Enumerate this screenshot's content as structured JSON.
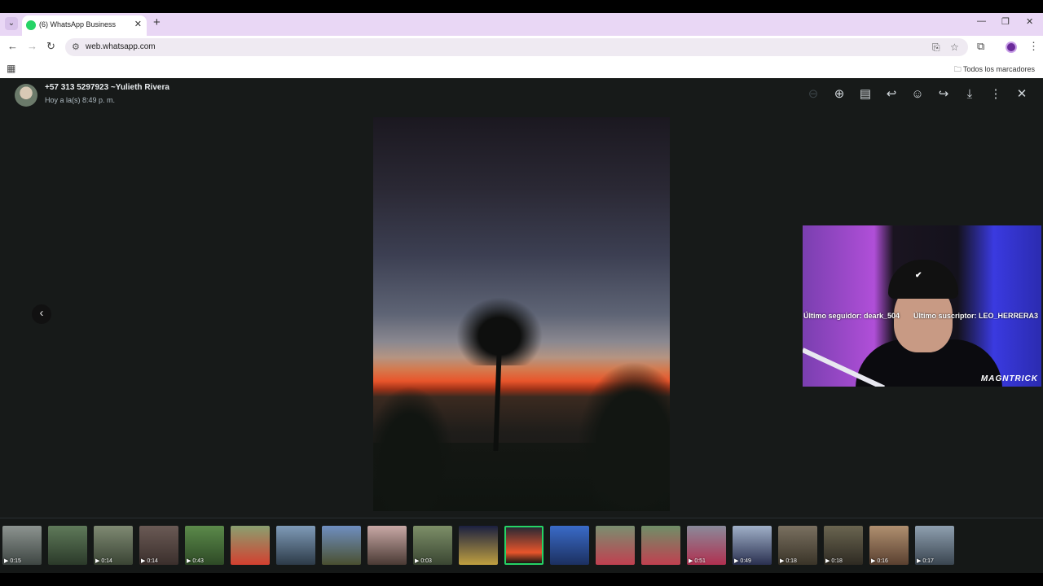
{
  "browser": {
    "tab_title": "(6) WhatsApp Business",
    "url": "web.whatsapp.com",
    "bookmarks_all": "Todos los marcadores"
  },
  "viewer": {
    "contact_name": "+57 313 5297923 ~Yulieth Rivera",
    "timestamp": "Hoy a la(s) 8:49 p. m.",
    "accent_color": "#25d366"
  },
  "stream_overlay": {
    "brand": "MAGNTRICK",
    "last_follower": "Último seguidor: deark_504",
    "last_subscriber": "Último suscriptor: LEO_HERRERA3"
  },
  "thumbnails": [
    {
      "duration": "0:15",
      "bg": "linear-gradient(180deg,#8d9490,#3e4643)"
    },
    {
      "duration": "",
      "bg": "linear-gradient(180deg,#5f7a5a,#2b3a2a)"
    },
    {
      "duration": "0:14",
      "bg": "linear-gradient(180deg,#7f8a73,#3a4434)"
    },
    {
      "duration": "0:14",
      "bg": "linear-gradient(180deg,#6a5a55,#3b2f2c)"
    },
    {
      "duration": "0:43",
      "bg": "linear-gradient(180deg,#5b8a4a,#2e4a26)"
    },
    {
      "duration": "",
      "bg": "linear-gradient(180deg,#8aa070,#d34030)"
    },
    {
      "duration": "",
      "bg": "linear-gradient(180deg,#7f9bb8,#2d3b48)"
    },
    {
      "duration": "",
      "bg": "linear-gradient(180deg,#6f8fc0,#4a5030)"
    },
    {
      "duration": "",
      "bg": "linear-gradient(180deg,#c9a9a6,#4a3a34)"
    },
    {
      "duration": "0:03",
      "bg": "linear-gradient(180deg,#7d8f68,#3a4632)"
    },
    {
      "duration": "",
      "bg": "linear-gradient(180deg,#1b2040,#c0a040)"
    },
    {
      "duration": "",
      "bg": "linear-gradient(180deg,#2a2834,#e8552b 70%,#141613)"
    },
    {
      "duration": "",
      "bg": "linear-gradient(180deg,#3a6bc8,#1c3060)"
    },
    {
      "duration": "",
      "bg": "linear-gradient(180deg,#7a8f70,#c04050)"
    },
    {
      "duration": "",
      "bg": "linear-gradient(180deg,#6f8f68,#c04050)"
    },
    {
      "duration": "0:51",
      "bg": "linear-gradient(180deg,#8a8a9a,#b03050)"
    },
    {
      "duration": "0:49",
      "bg": "linear-gradient(180deg,#a0b0c8,#2a3050)"
    },
    {
      "duration": "0:18",
      "bg": "linear-gradient(180deg,#7a7060,#3a3428)"
    },
    {
      "duration": "0:18",
      "bg": "linear-gradient(180deg,#6a6550,#2e2a22)"
    },
    {
      "duration": "0:16",
      "bg": "linear-gradient(180deg,#b09070,#5a4030)"
    },
    {
      "duration": "0:17",
      "bg": "linear-gradient(180deg,#8fa0b0,#3a4550)"
    }
  ]
}
